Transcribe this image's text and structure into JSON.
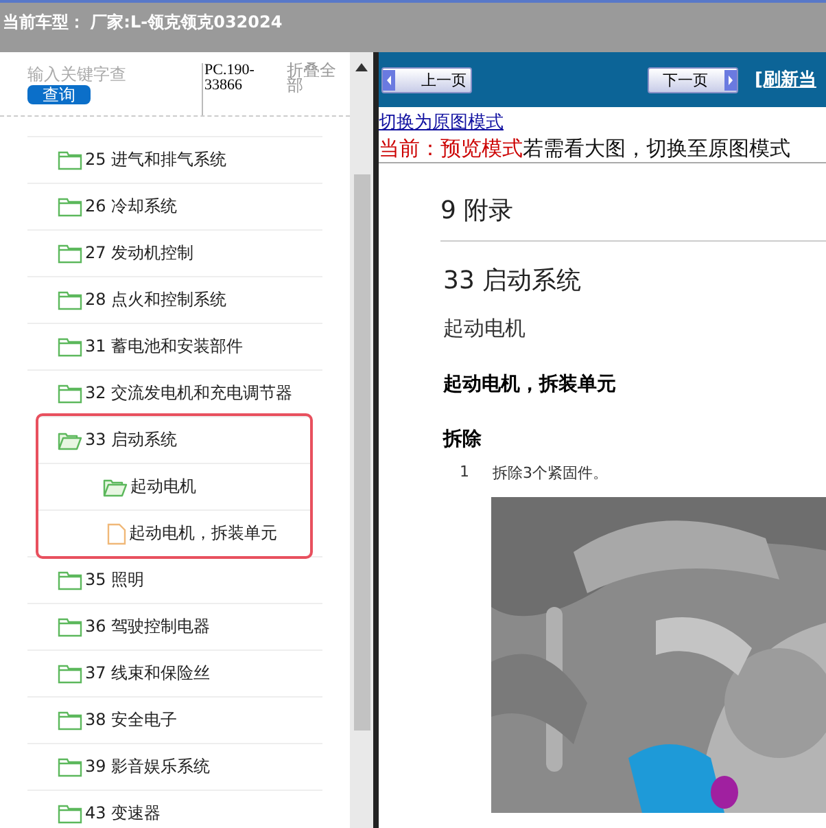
{
  "header": {
    "car_model": "当前车型： 厂家:L-领克领克032024"
  },
  "search": {
    "placeholder": "输入关键字查",
    "button": "查询",
    "code": "PC.190-33866",
    "collapse_all": "折叠全部"
  },
  "tree": [
    {
      "label": "25 进气和排气系统",
      "kind": "folder",
      "expanded": false,
      "highlighted": false
    },
    {
      "label": "26 冷却系统",
      "kind": "folder",
      "expanded": false,
      "highlighted": false
    },
    {
      "label": "27 发动机控制",
      "kind": "folder",
      "expanded": false,
      "highlighted": false
    },
    {
      "label": "28 点火和控制系统",
      "kind": "folder",
      "expanded": false,
      "highlighted": false
    },
    {
      "label": "31 蓄电池和安装部件",
      "kind": "folder",
      "expanded": false,
      "highlighted": false
    },
    {
      "label": "32 交流发电机和充电调节器",
      "kind": "folder",
      "expanded": false,
      "highlighted": false
    },
    {
      "label": "33 启动系统",
      "kind": "folder",
      "expanded": true,
      "highlighted": true,
      "children": [
        {
          "label": "起动电机",
          "kind": "folder",
          "expanded": true,
          "children": [
            {
              "label": "起动电机，拆装单元",
              "kind": "document"
            }
          ]
        }
      ]
    },
    {
      "label": "35 照明",
      "kind": "folder",
      "expanded": false,
      "highlighted": false
    },
    {
      "label": "36 驾驶控制电器",
      "kind": "folder",
      "expanded": false,
      "highlighted": false
    },
    {
      "label": "37 线束和保险丝",
      "kind": "folder",
      "expanded": false,
      "highlighted": false
    },
    {
      "label": "38 安全电子",
      "kind": "folder",
      "expanded": false,
      "highlighted": false
    },
    {
      "label": "39 影音娱乐系统",
      "kind": "folder",
      "expanded": false,
      "highlighted": false
    },
    {
      "label": "43 变速器",
      "kind": "folder",
      "expanded": false,
      "highlighted": false
    }
  ],
  "viewer": {
    "prev_button": "上一页",
    "next_button": "下一页",
    "refresh_link": "[刷新当",
    "mode_link": "切换为原图模式",
    "mode_label": "当前：预览模式",
    "mode_hint": "若需看大图，切换至原图模式"
  },
  "document": {
    "chapter": "9 附录",
    "section": "33 启动系统",
    "subsection": "起动电机",
    "title": "起动电机，拆装单元",
    "step_heading": "拆除",
    "steps": [
      {
        "number": "1",
        "text": "拆除3个紧固件。"
      }
    ]
  }
}
